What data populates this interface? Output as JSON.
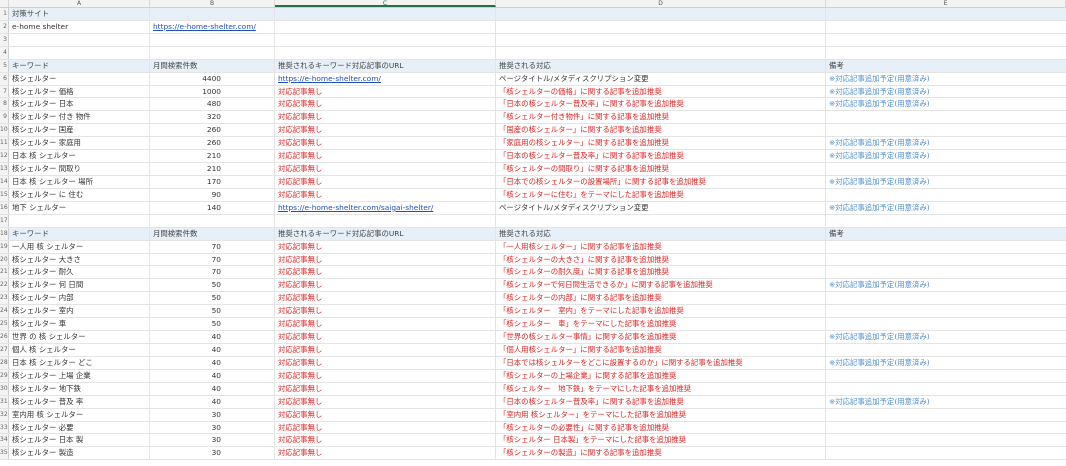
{
  "columns": [
    "A",
    "B",
    "C",
    "D",
    "E"
  ],
  "rows": [
    {
      "n": "1",
      "tint": true,
      "a": "対策サイト",
      "b": "",
      "c": "",
      "d": "",
      "e": ""
    },
    {
      "n": "2",
      "a": "e-home shelter",
      "b": "https://e-home-shelter.com/",
      "c": "",
      "d": "",
      "e": ""
    },
    {
      "n": "3",
      "a": "",
      "b": "",
      "c": "",
      "d": "",
      "e": ""
    },
    {
      "n": "4",
      "a": "",
      "b": "",
      "c": "",
      "d": "",
      "e": ""
    },
    {
      "n": "5",
      "tint": true,
      "a": "キーワード",
      "b": "月間検索件数",
      "c": "推奨されるキーワード対応記事のURL",
      "d": "推奨される対応",
      "e": "備考"
    },
    {
      "n": "6",
      "a": "核シェルター",
      "b": "4400",
      "c": "https://e-home-shelter.com/",
      "d": "ページタイトル/メタディスクリプション変更",
      "e": "※対応記事追加予定(用意済み)"
    },
    {
      "n": "7",
      "a": "核シェルター 価格",
      "b": "1000",
      "c": "対応記事無し",
      "d": "「核シェルターの価格」に関する記事を追加推奨",
      "e": "※対応記事追加予定(用意済み)"
    },
    {
      "n": "8",
      "a": "核シェルター 日本",
      "b": "480",
      "c": "対応記事無し",
      "d": "「日本の核シェルター普及率」に関する記事を追加推奨",
      "e": "※対応記事追加予定(用意済み)"
    },
    {
      "n": "9",
      "a": "核シェルター 付き 物件",
      "b": "320",
      "c": "対応記事無し",
      "d": "「核シェルター付き物件」に関する記事を追加推奨",
      "e": ""
    },
    {
      "n": "10",
      "a": "核シェルター 国産",
      "b": "260",
      "c": "対応記事無し",
      "d": "「国産の核シェルター」に関する記事を追加推奨",
      "e": ""
    },
    {
      "n": "11",
      "a": "核シェルター 家庭用",
      "b": "260",
      "c": "対応記事無し",
      "d": "「家庭用の核シェルター」に関する記事を追加推奨",
      "e": "※対応記事追加予定(用意済み)"
    },
    {
      "n": "12",
      "a": "日本 核 シェルター",
      "b": "210",
      "c": "対応記事無し",
      "d": "「日本の核シェルター普及率」に関する記事を追加推奨",
      "e": "※対応記事追加予定(用意済み)"
    },
    {
      "n": "13",
      "a": "核シェルター 間取り",
      "b": "210",
      "c": "対応記事無し",
      "d": "「核シェルターの間取り」に関する記事を追加推奨",
      "e": ""
    },
    {
      "n": "14",
      "a": "日本 核 シェルター 場所",
      "b": "170",
      "c": "対応記事無し",
      "d": "「日本での核シェルターの設置場所」に関する記事を追加推奨",
      "e": "※対応記事追加予定(用意済み)"
    },
    {
      "n": "15",
      "a": "核シェルター に 住む",
      "b": "90",
      "c": "対応記事無し",
      "d": "「核シェルターに住む」をテーマにした記事を追加推奨",
      "e": ""
    },
    {
      "n": "16",
      "a": "地下 シェルター",
      "b": "140",
      "c": "https://e-home-shelter.com/saigai-shelter/",
      "d": "ページタイトル/メタディスクリプション変更",
      "e": "※対応記事追加予定(用意済み)"
    },
    {
      "n": "17",
      "a": "",
      "b": "",
      "c": "",
      "d": "",
      "e": ""
    },
    {
      "n": "18",
      "tint": true,
      "a": "キーワード",
      "b": "月間検索件数",
      "c": "推奨されるキーワード対応記事のURL",
      "d": "推奨される対応",
      "e": "備考"
    },
    {
      "n": "19",
      "a": "一人用 核 シェルター",
      "b": "70",
      "c": "対応記事無し",
      "d": "「一人用核シェルター」に関する記事を追加推奨",
      "e": ""
    },
    {
      "n": "20",
      "a": "核シェルター 大きさ",
      "b": "70",
      "c": "対応記事無し",
      "d": "「核シェルターの大きさ」に関する記事を追加推奨",
      "e": ""
    },
    {
      "n": "21",
      "a": "核シェルター 耐久",
      "b": "70",
      "c": "対応記事無し",
      "d": "「核シェルターの耐久度」に関する記事を追加推奨",
      "e": ""
    },
    {
      "n": "22",
      "a": "核シェルター 何 日間",
      "b": "50",
      "c": "対応記事無し",
      "d": "「核シェルターで何日間生活できるか」に関する記事を追加推奨",
      "e": "※対応記事追加予定(用意済み)"
    },
    {
      "n": "23",
      "a": "核シェルター 内部",
      "b": "50",
      "c": "対応記事無し",
      "d": "「核シェルターの内部」に関する記事を追加推奨",
      "e": ""
    },
    {
      "n": "24",
      "a": "核シェルター 室内",
      "b": "50",
      "c": "対応記事無し",
      "d": "「核シェルター　室内」をテーマにした記事を追加推奨",
      "e": ""
    },
    {
      "n": "25",
      "a": "核シェルター 車",
      "b": "50",
      "c": "対応記事無し",
      "d": "「核シェルター　車」をテーマにした記事を追加推奨",
      "e": ""
    },
    {
      "n": "26",
      "a": "世界 の 核 シェルター",
      "b": "40",
      "c": "対応記事無し",
      "d": "「世界の核シェルター事情」に関する記事を追加推奨",
      "e": "※対応記事追加予定(用意済み)"
    },
    {
      "n": "27",
      "a": "個人 核 シェルター",
      "b": "40",
      "c": "対応記事無し",
      "d": "「個人用核シェルター」に関する記事を追加推奨",
      "e": ""
    },
    {
      "n": "28",
      "a": "日本 核 シェルター どこ",
      "b": "40",
      "c": "対応記事無し",
      "d": "「日本では核シェルターをどこに設置するのか」に関する記事を追加推奨",
      "e": "※対応記事追加予定(用意済み)"
    },
    {
      "n": "29",
      "a": "核シェルター 上場 企業",
      "b": "40",
      "c": "対応記事無し",
      "d": "「核シェルターの上場企業」に関する記事を追加推奨",
      "e": ""
    },
    {
      "n": "30",
      "a": "核シェルター 地下鉄",
      "b": "40",
      "c": "対応記事無し",
      "d": "「核シェルター　地下鉄」をテーマにした記事を追加推奨",
      "e": ""
    },
    {
      "n": "31",
      "a": "核シェルター 普及 率",
      "b": "40",
      "c": "対応記事無し",
      "d": "「日本の核シェルター普及率」に関する記事を追加推奨",
      "e": "※対応記事追加予定(用意済み)"
    },
    {
      "n": "32",
      "a": "室内用 核 シェルター",
      "b": "30",
      "c": "対応記事無し",
      "d": "「室内用 核シェルター」をテーマにした記事を追加推奨",
      "e": ""
    },
    {
      "n": "33",
      "a": "核シェルター 必要",
      "b": "30",
      "c": "対応記事無し",
      "d": "「核シェルターの必要性」に関する記事を追加推奨",
      "e": ""
    },
    {
      "n": "34",
      "a": "核シェルター 日本 製",
      "b": "30",
      "c": "対応記事無し",
      "d": "「核シェルター 日本製」をテーマにした記事を追加推奨",
      "e": ""
    },
    {
      "n": "35",
      "a": "核シェルター 製造",
      "b": "30",
      "c": "対応記事無し",
      "d": "「核シェルターの製造」に関する記事を追加推奨",
      "e": ""
    }
  ]
}
